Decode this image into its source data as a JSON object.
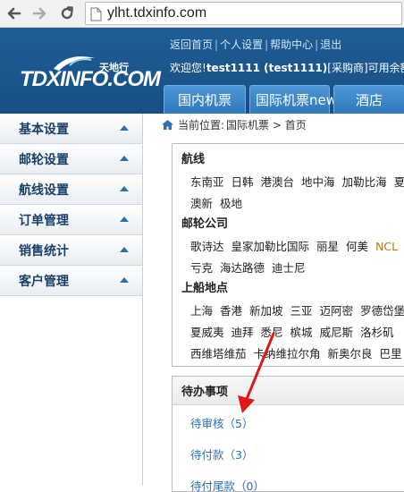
{
  "browser": {
    "url": "ylht.tdxinfo.com",
    "back_icon": "back-arrow-icon",
    "forward_icon": "forward-arrow-icon",
    "reload_icon": "reload-icon"
  },
  "header": {
    "logo_text": "TDXINFO.COM",
    "logo_cn": "天地行",
    "top_links": [
      "返回首页",
      "个人设置",
      "帮助中心",
      "退出"
    ],
    "welcome": {
      "prefix": "欢迎您!",
      "user": "test1111 (test1111)",
      "role": "[采购商]",
      "balance_label": "可用余额:"
    },
    "tabs": [
      "国内机票",
      "国际机票new",
      "酒店"
    ]
  },
  "sidebar": {
    "items": [
      {
        "label": "基本设置"
      },
      {
        "label": "邮轮设置"
      },
      {
        "label": "航线设置"
      },
      {
        "label": "订单管理"
      },
      {
        "label": "销售统计"
      },
      {
        "label": "客户管理"
      }
    ]
  },
  "breadcrumb": {
    "prefix": "当前位置:",
    "path": "国际机票 > 首页"
  },
  "routes": {
    "title": "航线",
    "row1": [
      "东南亚",
      "日韩",
      "港澳台",
      "地中海",
      "加勒比海",
      "夏"
    ],
    "row2": [
      "澳新",
      "极地"
    ]
  },
  "cruise_companies": {
    "title": "邮轮公司",
    "row1": [
      "歌诗达",
      "皇家加勒比国际",
      "丽星",
      "何美",
      "NCL"
    ],
    "row2": [
      "亏克",
      "海达路德",
      "迪士尼"
    ]
  },
  "ports": {
    "title": "上船地点",
    "row1": [
      "上海",
      "香港",
      "新加坡",
      "三亚",
      "迈阿密",
      "罗德岱堡"
    ],
    "row2": [
      "夏威夷",
      "迪拜",
      "悉尼",
      "槟城",
      "威尼斯",
      "洛杉矶"
    ],
    "row3": [
      "西维塔维茄",
      "卡纳维拉尔角",
      "新奥尔良",
      "巴里"
    ]
  },
  "todo": {
    "title": "待办事项",
    "items": [
      "待审核（5）",
      "待付款（3）",
      "待付尾款（0）"
    ]
  },
  "colors": {
    "header_bg": "#1b5690",
    "tab_bg": "#3b86c8",
    "sidebar_text": "#1a3f66",
    "link": "#2a6fb5",
    "annotation_arrow": "#e01818"
  }
}
